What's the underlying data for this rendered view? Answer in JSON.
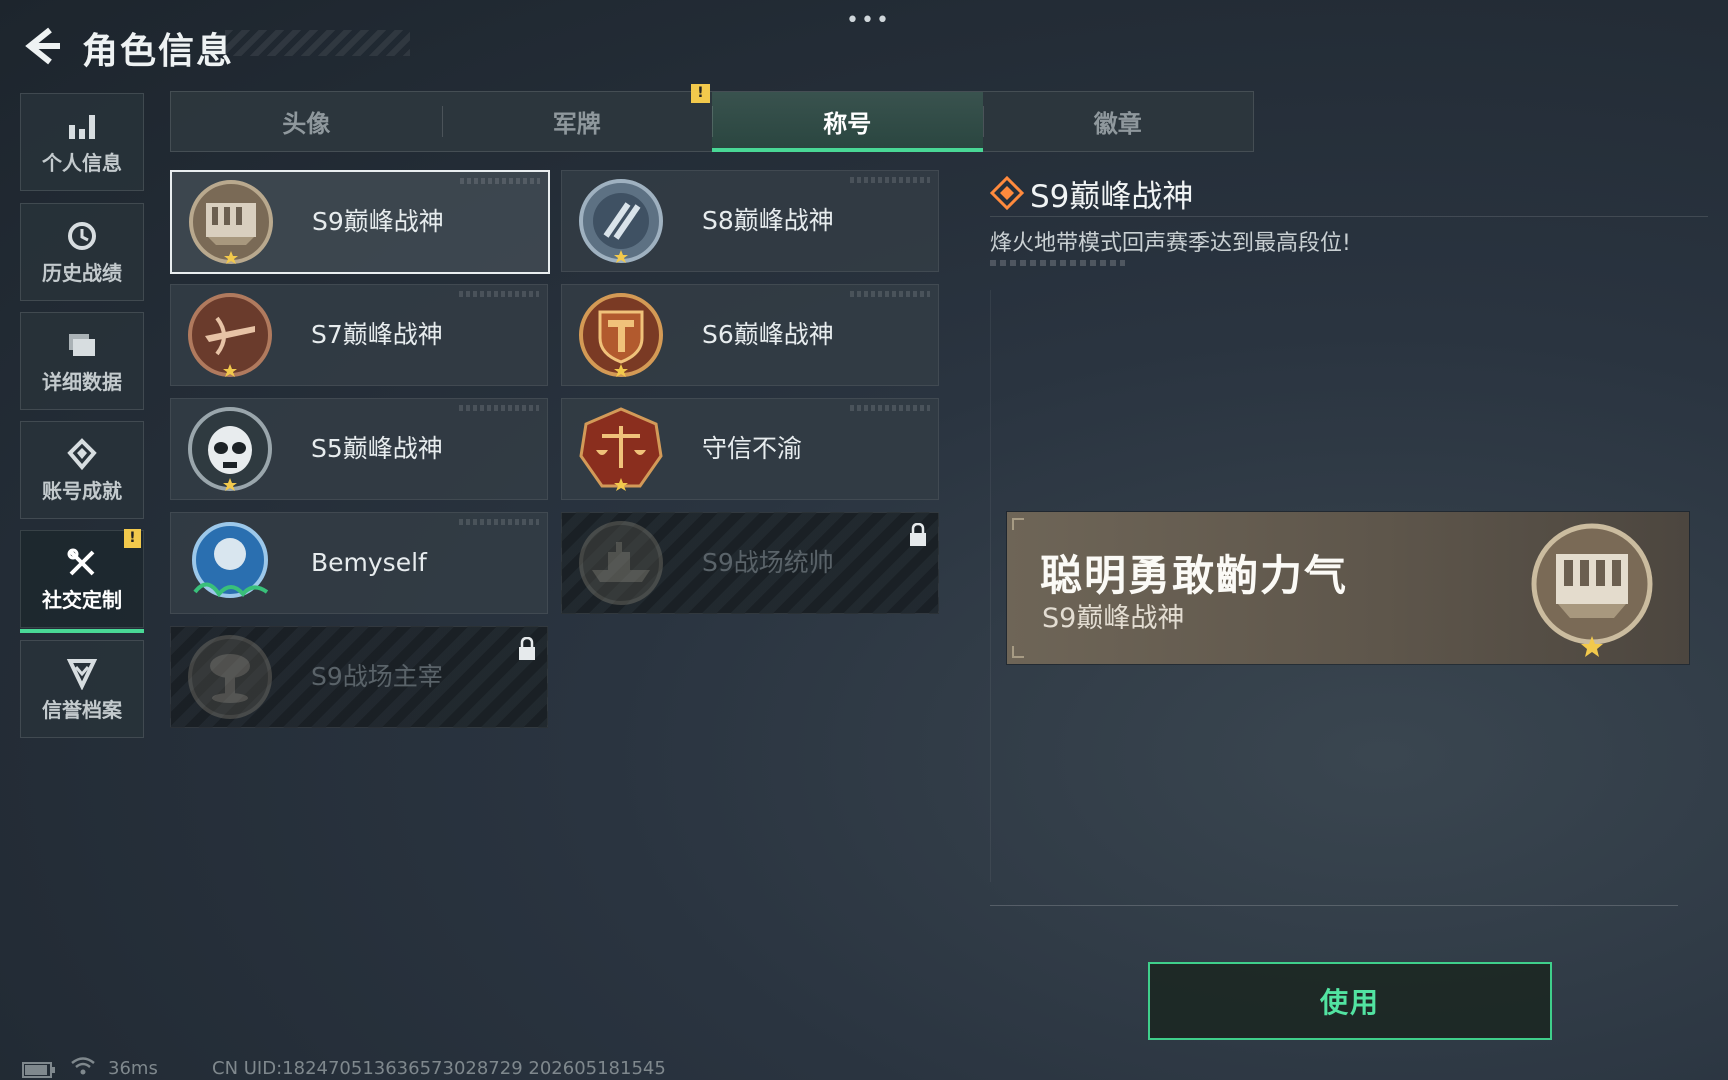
{
  "header": {
    "title": "角色信息",
    "more": "•••"
  },
  "sidebar": {
    "items": [
      {
        "label": "个人信息",
        "icon": "bar-chart-icon"
      },
      {
        "label": "历史战绩",
        "icon": "history-clock-icon"
      },
      {
        "label": "详细数据",
        "icon": "folder-icon"
      },
      {
        "label": "账号成就",
        "icon": "achievement-badge-icon"
      },
      {
        "label": "社交定制",
        "icon": "tools-icon",
        "active": true,
        "badge": "!"
      },
      {
        "label": "信誉档案",
        "icon": "shield-chevron-icon"
      }
    ]
  },
  "tabs": {
    "items": [
      {
        "label": "头像"
      },
      {
        "label": "军牌",
        "badge": "!"
      },
      {
        "label": "称号",
        "active": true
      },
      {
        "label": "徽章"
      }
    ]
  },
  "titles": {
    "items": [
      {
        "label": "S9巅峰战神",
        "emblem": "fortress-emblem-icon",
        "selected": true,
        "locked": false
      },
      {
        "label": "S8巅峰战神",
        "emblem": "slash-emblem-icon",
        "selected": false,
        "locked": false
      },
      {
        "label": "S7巅峰战神",
        "emblem": "crossbow-emblem-icon",
        "selected": false,
        "locked": false
      },
      {
        "label": "S6巅峰战神",
        "emblem": "t-shield-emblem-icon",
        "selected": false,
        "locked": false
      },
      {
        "label": "S5巅峰战神",
        "emblem": "skull-mask-emblem-icon",
        "selected": false,
        "locked": false
      },
      {
        "label": "守信不渝",
        "emblem": "scales-emblem-icon",
        "selected": false,
        "locked": false
      },
      {
        "label": "Bemyself",
        "emblem": "signature-emblem-icon",
        "selected": false,
        "locked": false
      },
      {
        "label": "S9战场统帅",
        "emblem": "warship-emblem-icon",
        "selected": false,
        "locked": true
      },
      {
        "label": "S9战场主宰",
        "emblem": "mushroom-cloud-emblem-icon",
        "selected": false,
        "locked": true
      }
    ]
  },
  "detail": {
    "title": "S9巅峰战神",
    "description": "烽火地带模式回声赛季达到最高段位!",
    "icon": "diamond-icon"
  },
  "preview": {
    "player_name": "聪明勇敢齣力气",
    "title": "S9巅峰战神",
    "emblem": "fortress-emblem-icon"
  },
  "actions": {
    "use_label": "使用"
  },
  "status": {
    "ping": "36ms",
    "uid": "CN UID:182470513636573028729 202605181545"
  },
  "colors": {
    "accent": "#49d896",
    "warning": "#f2c94c",
    "preview_bg": "#6e6557"
  }
}
